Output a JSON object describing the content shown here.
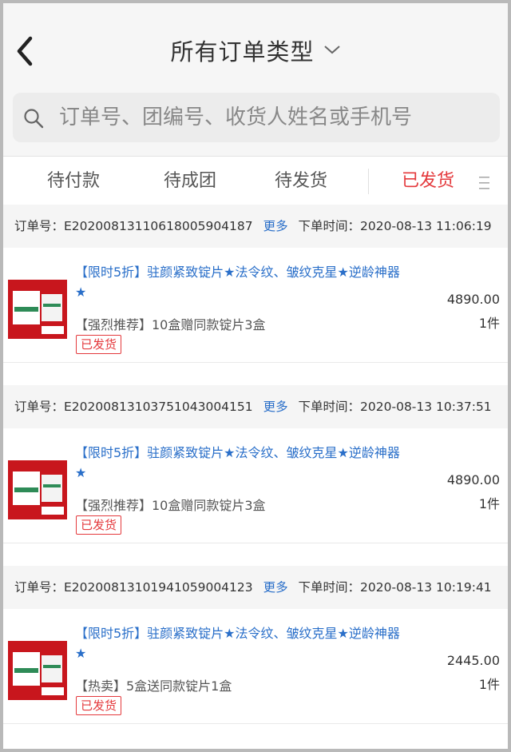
{
  "header": {
    "title": "所有订单类型",
    "search_placeholder": "订单号、团编号、收货人姓名或手机号"
  },
  "tabs": [
    {
      "label": "待付款",
      "active": false
    },
    {
      "label": "待成团",
      "active": false
    },
    {
      "label": "待发货",
      "active": false
    },
    {
      "label": "已发货",
      "active": true
    }
  ],
  "colors": {
    "accent": "#e4393c",
    "link": "#2a6fc9"
  },
  "icons": [
    "back-arrow-icon",
    "chevron-down-icon",
    "search-icon",
    "menu-icon"
  ],
  "orders": [
    {
      "order_label": "订单号：",
      "order_no": "E20200813110618005904187",
      "more": "更多",
      "time_label": "下单时间：",
      "time": "2020-08-13 11:06:19",
      "product_title": "【限时5折】驻颜紧致锭片★法令纹、皱纹克星★逆龄神器★",
      "spec": "【强烈推荐】10盒赠同款锭片3盒",
      "status": "已发货",
      "price": "4890.00",
      "qty": "1件"
    },
    {
      "order_label": "订单号：",
      "order_no": "E20200813103751043004151",
      "more": "更多",
      "time_label": "下单时间：",
      "time": "2020-08-13 10:37:51",
      "product_title": "【限时5折】驻颜紧致锭片★法令纹、皱纹克星★逆龄神器★",
      "spec": "【强烈推荐】10盒赠同款锭片3盒",
      "status": "已发货",
      "price": "4890.00",
      "qty": "1件"
    },
    {
      "order_label": "订单号：",
      "order_no": "E20200813101941059004123",
      "more": "更多",
      "time_label": "下单时间：",
      "time": "2020-08-13 10:19:41",
      "product_title": "【限时5折】驻颜紧致锭片★法令纹、皱纹克星★逆龄神器★",
      "spec": "【热卖】5盒送同款锭片1盒",
      "status": "已发货",
      "price": "2445.00",
      "qty": "1件"
    }
  ]
}
